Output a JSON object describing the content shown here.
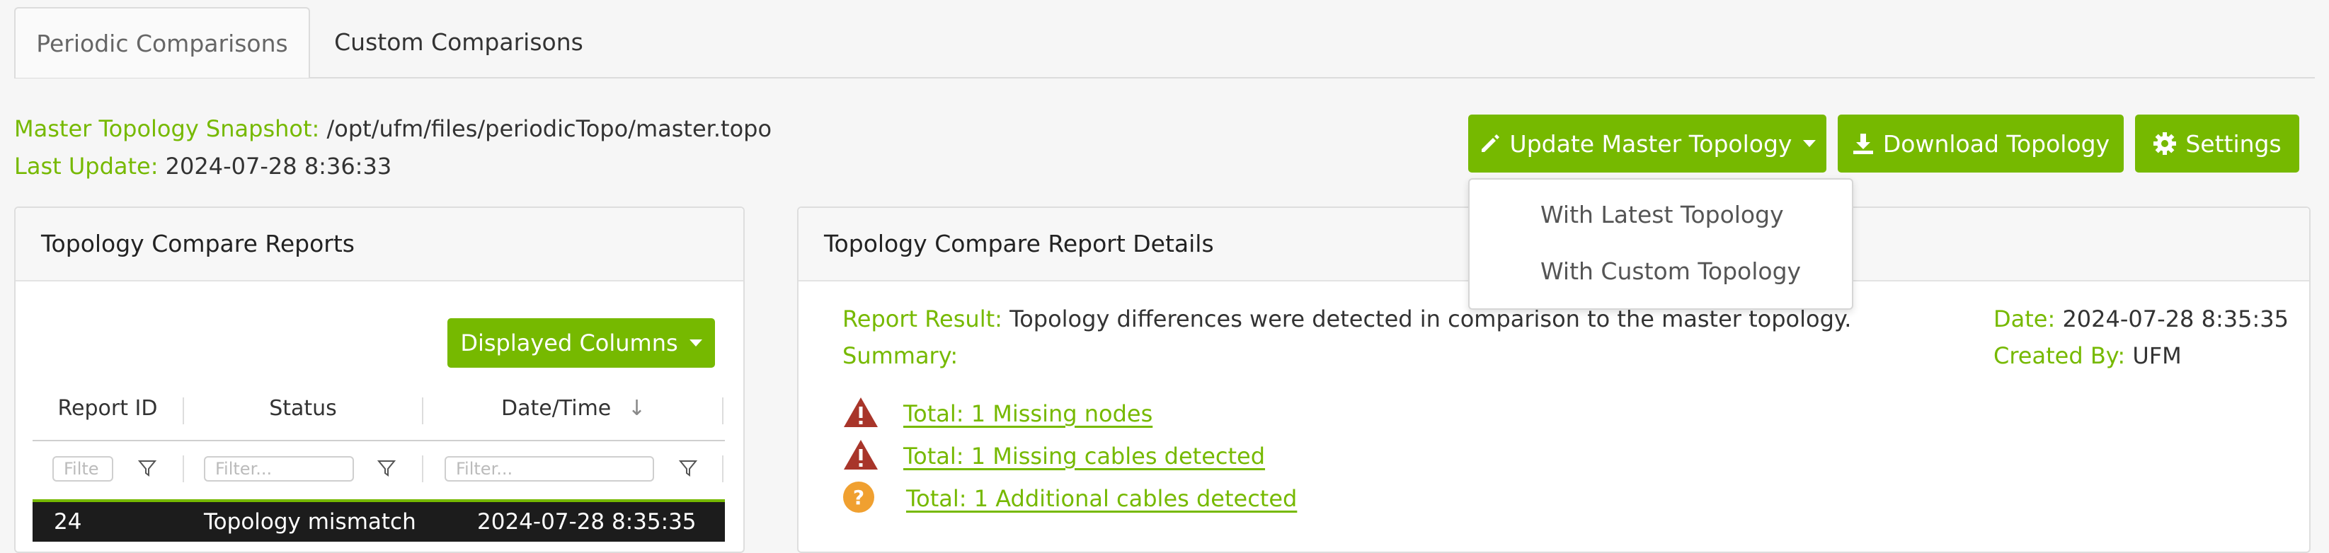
{
  "tabs": [
    {
      "label": "Periodic Comparisons"
    },
    {
      "label": "Custom Comparisons"
    }
  ],
  "snapshot": {
    "master_label": "Master Topology Snapshot:",
    "master_path": "/opt/ufm/files/periodicTopo/master.topo",
    "last_update_label": "Last Update:",
    "last_update_value": "2024-07-28 8:36:33"
  },
  "toolbar": {
    "update_label": "Update Master Topology",
    "download_label": "Download Topology",
    "settings_label": "Settings"
  },
  "update_menu": {
    "items": [
      "With Latest Topology",
      "With Custom Topology"
    ]
  },
  "reports_panel": {
    "title": "Topology Compare Reports",
    "displayed_columns_label": "Displayed Columns",
    "columns": [
      "Report ID",
      "Status",
      "Date/Time"
    ],
    "sort_indicator": "↓",
    "filter_placeholders": [
      "Filte",
      "Filter...",
      "Filter..."
    ],
    "rows": [
      {
        "id": "24",
        "status": "Topology mismatch",
        "datetime": "2024-07-28 8:35:35"
      }
    ]
  },
  "details_panel": {
    "title": "Topology Compare Report Details",
    "result_label": "Report Result:",
    "result_text": "Topology differences were detected in comparison to the master topology.",
    "summary_label": "Summary:",
    "date_label": "Date:",
    "date_value": "2024-07-28 8:35:35",
    "created_by_label": "Created By:",
    "created_by_value": "UFM",
    "items": [
      {
        "icon": "warning-icon",
        "text": "Total: 1 Missing nodes"
      },
      {
        "icon": "warning-icon",
        "text": "Total: 1 Missing cables detected"
      },
      {
        "icon": "question-icon",
        "text": "Total: 1 Additional cables detected"
      }
    ]
  },
  "colors": {
    "accent": "#76b900",
    "warning": "#a8352a",
    "question": "#f0a030"
  }
}
